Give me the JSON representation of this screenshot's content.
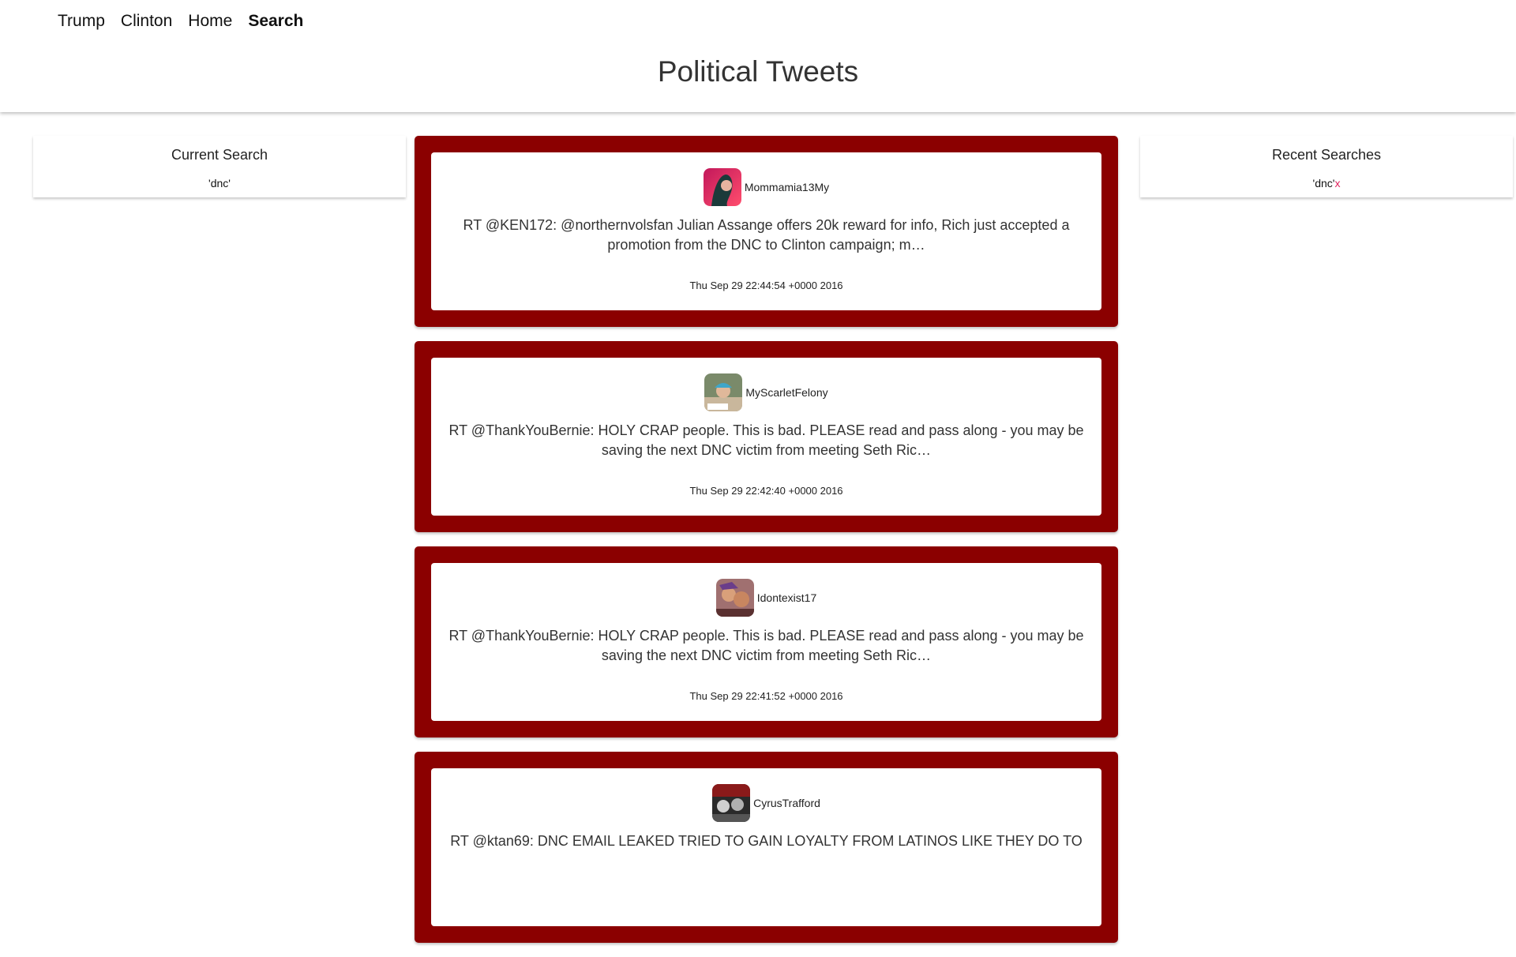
{
  "nav": {
    "items": [
      {
        "label": "Trump",
        "active": false
      },
      {
        "label": "Clinton",
        "active": false
      },
      {
        "label": "Home",
        "active": false
      },
      {
        "label": "Search",
        "active": true
      }
    ]
  },
  "page_title": "Political Tweets",
  "current_search": {
    "title": "Current Search",
    "value": "'dnc'"
  },
  "recent_searches": {
    "title": "Recent Searches",
    "items": [
      {
        "value": "'dnc'",
        "remove": "x"
      }
    ]
  },
  "colors": {
    "card_border": "#8b0000",
    "remove_x": "#e0245e"
  },
  "tweets": [
    {
      "username": "Mommamia13My",
      "avatar_icon": "user-avatar-icon",
      "text": "RT @KEN172: @northernvolsfan Julian Assange offers 20k reward for info, Rich just accepted a promotion from the DNC to Clinton campaign; m…",
      "date": "Thu Sep 29 22:44:54 +0000 2016"
    },
    {
      "username": "MyScarletFelony",
      "avatar_icon": "user-avatar-icon",
      "text": "RT @ThankYouBernie: HOLY CRAP people. This is bad. PLEASE read and pass along - you may be saving the next DNC victim from meeting Seth Ric…",
      "date": "Thu Sep 29 22:42:40 +0000 2016"
    },
    {
      "username": "Idontexist17",
      "avatar_icon": "user-avatar-icon",
      "text": "RT @ThankYouBernie: HOLY CRAP people. This is bad. PLEASE read and pass along - you may be saving the next DNC victim from meeting Seth Ric…",
      "date": "Thu Sep 29 22:41:52 +0000 2016"
    },
    {
      "username": "CyrusTrafford",
      "avatar_icon": "user-avatar-icon",
      "text": "RT @ktan69: DNC EMAIL LEAKED TRIED TO GAIN LOYALTY FROM LATINOS LIKE THEY DO TO",
      "date": ""
    }
  ]
}
